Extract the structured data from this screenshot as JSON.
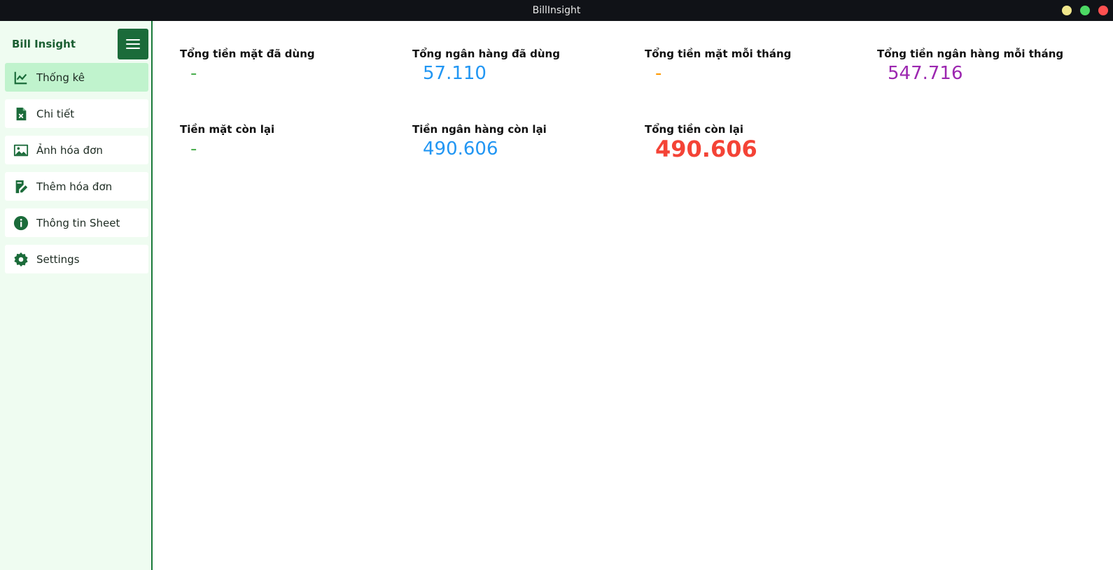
{
  "window": {
    "title": "BillInsight"
  },
  "sidebar": {
    "brand": "Bill Insight",
    "items": [
      {
        "label": "Thống kê",
        "icon": "chart-line-icon",
        "active": true
      },
      {
        "label": "Chi tiết",
        "icon": "spreadsheet-file-icon"
      },
      {
        "label": "Ảnh hóa đơn",
        "icon": "image-icon"
      },
      {
        "label": "Thêm hóa đơn",
        "icon": "edit-document-icon"
      },
      {
        "label": "Thông tin Sheet",
        "icon": "info-icon"
      },
      {
        "label": "Settings",
        "icon": "gear-icon"
      }
    ]
  },
  "stats": [
    {
      "label": "Tổng tiền mặt đã dùng",
      "value": "-",
      "color": "#4caf50"
    },
    {
      "label": "Tổng ngân hàng đã dùng",
      "value": "57.110",
      "color": "#2196f3"
    },
    {
      "label": "Tổng tiền mặt mỗi tháng",
      "value": "-",
      "color": "#ff9800"
    },
    {
      "label": "Tổng tiền ngân hàng mỗi tháng",
      "value": "547.716",
      "color": "#9c27b0"
    },
    {
      "label": "Tiền mặt còn lại",
      "value": "-",
      "color": "#4caf50"
    },
    {
      "label": "Tiền ngân hàng còn lại",
      "value": "490.606",
      "color": "#2196f3"
    },
    {
      "label": "Tổng tiền còn lại",
      "value": "490.606",
      "color": "#f44336"
    }
  ],
  "colors": {
    "accent": "#1b6b3a",
    "sidebar_bg": "#effcf1",
    "active_bg": "#c0f3cd"
  }
}
